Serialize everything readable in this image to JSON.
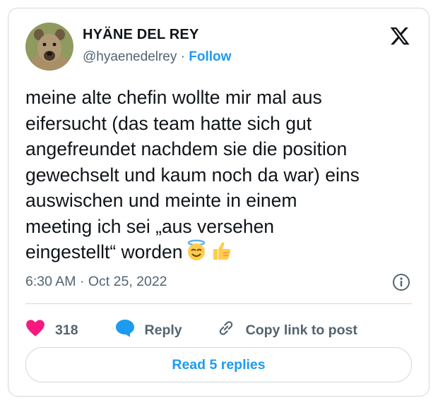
{
  "author": {
    "name": "HYÄNE DEL REY",
    "handle": "@hyaenedelrey",
    "separator": " · ",
    "follow_label": "Follow"
  },
  "tweet": {
    "text": "meine alte chefin wollte mir mal aus\neifersucht (das team hatte sich gut\nangefreundet nachdem sie die position\ngewechselt und kaum noch da war) eins\nauswischen und meinte in einem\nmeeting ich sei „aus versehen\neingestellt“ worden",
    "emojis": [
      "smiling-face-with-halo",
      "thumbs-up"
    ],
    "timestamp": "6:30 AM · Oct 25, 2022"
  },
  "actions": {
    "like_count": "318",
    "reply_label": "Reply",
    "copy_label": "Copy link to post"
  },
  "read_replies_label": "Read 5 replies",
  "colors": {
    "accent": "#1d9bf0",
    "like": "#f91880",
    "text": "#0f1419",
    "muted": "#536471",
    "border": "#cfd9de"
  }
}
